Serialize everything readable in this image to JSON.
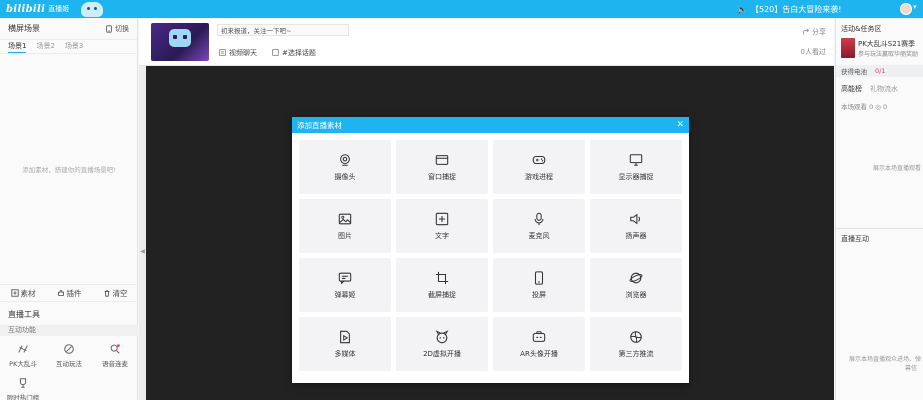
{
  "topbar": {
    "logo": "bilibili",
    "logo_sub": "直播姬",
    "announcement": "【520】告白大冒险来袭!"
  },
  "left_panel": {
    "title": "横屏场景",
    "switch_label": "切换",
    "scenes": [
      "场景1",
      "场景2",
      "场景3"
    ],
    "empty_hint": "添加素材，搭建你的直播场景吧!",
    "actions": {
      "material": "素材",
      "plugin": "插件",
      "clear": "清空"
    },
    "tools_title": "直播工具",
    "tools_subtitle": "互动功能",
    "tools": [
      {
        "label": "PK大乱斗",
        "icon": "pk-icon"
      },
      {
        "label": "互动玩法",
        "icon": "game-icon"
      },
      {
        "label": "语音连麦",
        "icon": "voice-icon"
      },
      {
        "label": "限时热门榜",
        "icon": "trophy-icon"
      }
    ]
  },
  "stream_header": {
    "title_input_value": "初来报道，关注一下吧~",
    "tag1": "视频聊天",
    "tag2": "#选择话题",
    "share_label": "分享",
    "viewers": "0人看过"
  },
  "modal": {
    "title": "添加直播素材",
    "items": [
      {
        "label": "摄像头",
        "icon": "camera-icon"
      },
      {
        "label": "窗口捕捉",
        "icon": "window-icon"
      },
      {
        "label": "游戏进程",
        "icon": "gamepad-icon"
      },
      {
        "label": "显示器捕捉",
        "icon": "monitor-icon"
      },
      {
        "label": "图片",
        "icon": "image-icon"
      },
      {
        "label": "文字",
        "icon": "text-icon"
      },
      {
        "label": "麦克风",
        "icon": "microphone-icon"
      },
      {
        "label": "扬声器",
        "icon": "speaker-icon"
      },
      {
        "label": "弹幕姬",
        "icon": "danmaku-icon"
      },
      {
        "label": "截屏捕捉",
        "icon": "crop-icon"
      },
      {
        "label": "投屏",
        "icon": "phone-icon"
      },
      {
        "label": "浏览器",
        "icon": "browser-icon"
      },
      {
        "label": "多媒体",
        "icon": "media-file-icon"
      },
      {
        "label": "2D虚拟开播",
        "icon": "avatar-2d-icon"
      },
      {
        "label": "AR头像开播",
        "icon": "ar-icon"
      },
      {
        "label": "第三方推流",
        "icon": "stream-icon"
      }
    ]
  },
  "right_panel": {
    "events_title": "活动&任务区",
    "event_title": "PK大乱斗S21赛季",
    "event_desc": "参与玩法赢取华丽奖励",
    "battery_label": "获得电池",
    "battery_count": "0/1",
    "tab_high_energy": "高能榜",
    "tab_gift_flow": "礼物流水",
    "stat1": "本场观看",
    "stat1_value": "0",
    "stat2_value": "0",
    "hint1": "展示本场直播观看",
    "interaction_title": "直播互动",
    "hint2_line1": "展示本场直播观众进场、弹",
    "hint2_line2": "幕信"
  }
}
